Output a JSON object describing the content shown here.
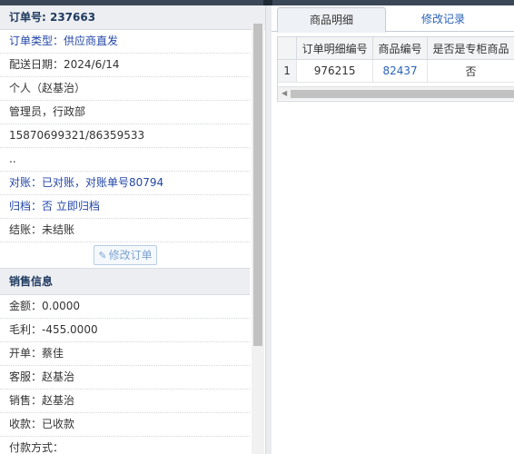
{
  "order": {
    "header": "订单号: 237663",
    "rows": [
      {
        "text": "订单类型：供应商直发",
        "link": true
      },
      {
        "text": "配送日期：2024/6/14",
        "link": false
      },
      {
        "text": "个人（赵基治）",
        "link": false
      },
      {
        "text": "管理员，行政部",
        "link": false
      },
      {
        "text": "15870699321/86359533",
        "link": false
      },
      {
        "text": "..",
        "link": false
      },
      {
        "text": "对账：已对账，对账单号80794",
        "link": true
      },
      {
        "text": "归档：否 立即归档",
        "link": true
      },
      {
        "text": "结账：未结账",
        "link": false
      }
    ],
    "edit_button": "修改订单"
  },
  "sales": {
    "title": "销售信息",
    "rows": [
      "金额：0.0000",
      "毛利：-455.0000",
      "开单：蔡佳",
      "客服：赵基治",
      "销售：赵基治",
      "收款：已收款",
      "付款方式："
    ]
  },
  "tabs": [
    {
      "label": "商品明细",
      "active": true
    },
    {
      "label": "修改记录",
      "active": false
    }
  ],
  "grid": {
    "headers": [
      "",
      "订单明细编号",
      "商品编号",
      "是否是专柜商品"
    ],
    "rows": [
      {
        "index": "1",
        "detail_id": "976215",
        "product_id": "82437",
        "is_counter": "否"
      }
    ]
  },
  "colors": {
    "link": "#2447a8",
    "header_bg": "#eceef1",
    "tab_link": "#2a62b8"
  }
}
